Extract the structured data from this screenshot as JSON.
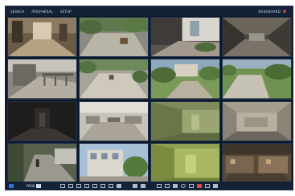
{
  "topbar": {
    "menu": [
      "SEARCH",
      "PERIPHERAL",
      "SETUP"
    ],
    "status": "DASHBOARD"
  },
  "grid": {
    "cells": [
      {
        "label": "",
        "scene": "hallway"
      },
      {
        "label": "",
        "scene": "courtyard"
      },
      {
        "label": "",
        "scene": "entrance"
      },
      {
        "label": "",
        "scene": "corridor-dark"
      },
      {
        "label": "",
        "scene": "balcony"
      },
      {
        "label": "",
        "scene": "plaza"
      },
      {
        "label": "",
        "scene": "garden"
      },
      {
        "label": "",
        "scene": "walkway"
      },
      {
        "label": "",
        "scene": "dark-room"
      },
      {
        "label": "",
        "scene": "office"
      },
      {
        "label": "",
        "scene": "room-green"
      },
      {
        "label": "",
        "scene": "room-wall"
      },
      {
        "label": "",
        "scene": "street"
      },
      {
        "label": "",
        "scene": "building"
      },
      {
        "label": "",
        "scene": "green-room"
      },
      {
        "label": "",
        "scene": "shop"
      }
    ]
  },
  "bottombar": {
    "page_label": "PAGE",
    "page_value": "1",
    "tool_icons": [
      "single-view-icon",
      "quad-view-icon",
      "nine-view-icon",
      "sixteen-view-icon",
      "grid-view-icon",
      "sequence-icon",
      "zoom-icon",
      "freeze-icon",
      "volume-icon",
      "play-icon",
      "layout-icon",
      "fullscreen-icon",
      "snapshot-icon",
      "record-icon",
      "playback-icon",
      "alarm-icon",
      "lock-icon",
      "settings-icon"
    ]
  }
}
